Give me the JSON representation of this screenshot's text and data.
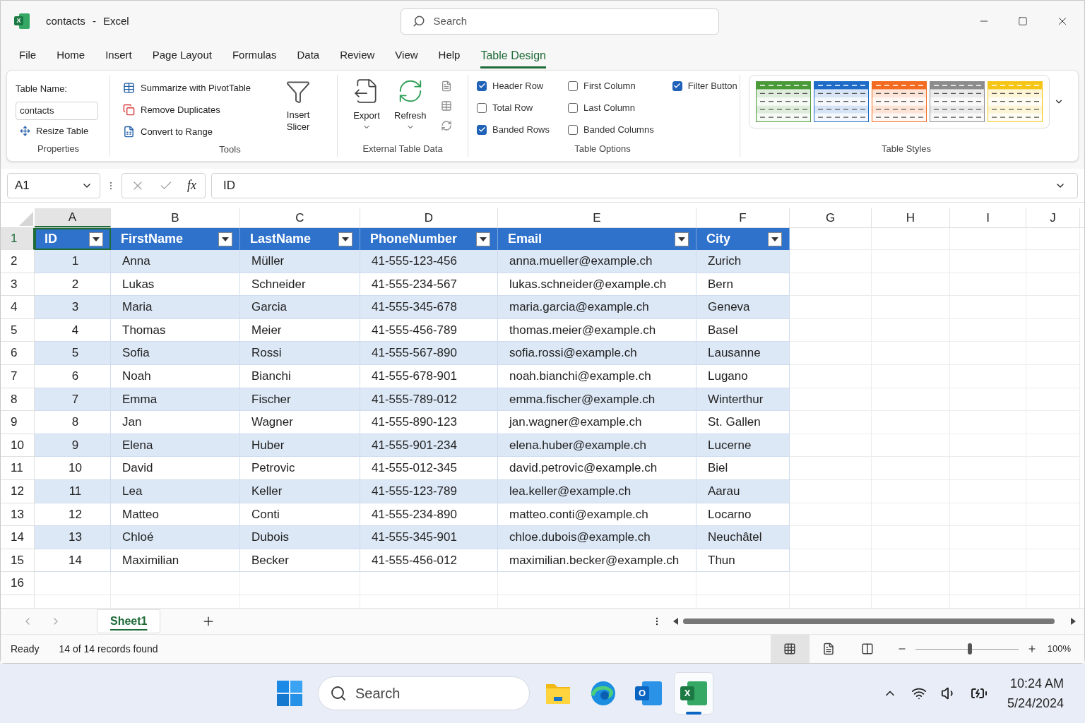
{
  "window": {
    "logo_letter": "X",
    "title": "contacts",
    "separator": "-",
    "app": "Excel",
    "search_placeholder": "Search"
  },
  "menu": [
    {
      "label": "File",
      "selected": false
    },
    {
      "label": "Home",
      "selected": false
    },
    {
      "label": "Insert",
      "selected": false
    },
    {
      "label": "Page Layout",
      "selected": false
    },
    {
      "label": "Formulas",
      "selected": false
    },
    {
      "label": "Data",
      "selected": false
    },
    {
      "label": "Review",
      "selected": false
    },
    {
      "label": "View",
      "selected": false
    },
    {
      "label": "Help",
      "selected": false
    },
    {
      "label": "Table Design",
      "selected": true
    }
  ],
  "ribbon": {
    "properties": {
      "label": "Properties",
      "table_name_label": "Table Name:",
      "table_name": "contacts",
      "resize": "Resize Table"
    },
    "tools": {
      "label": "Tools",
      "items": [
        "Summarize with PivotTable",
        "Remove Duplicates",
        "Convert to Range"
      ],
      "insert_slicer": "Insert Slicer"
    },
    "external": {
      "label": "External Table Data",
      "export": "Export",
      "refresh": "Refresh"
    },
    "table_options": {
      "label": "Table Options",
      "items": [
        {
          "label": "Header Row",
          "checked": true
        },
        {
          "label": "Total Row",
          "checked": false
        },
        {
          "label": "Banded Rows",
          "checked": true
        },
        {
          "label": "First Column",
          "checked": false
        },
        {
          "label": "Last Column",
          "checked": false
        },
        {
          "label": "Banded Columns",
          "checked": false
        },
        {
          "label": "Filter Button",
          "checked": true
        }
      ]
    },
    "table_styles": {
      "label": "Table Styles",
      "items": [
        {
          "color": "#4a9a3a"
        },
        {
          "color": "#1e6cc8"
        },
        {
          "color": "#f26b21"
        },
        {
          "color": "#8c8c8c"
        },
        {
          "color": "#f5c518"
        }
      ]
    }
  },
  "formula_bar": {
    "name_box": "A1",
    "function_label": "fx",
    "content": "ID"
  },
  "column_letters": [
    "A",
    "B",
    "C",
    "D",
    "E",
    "F",
    "G",
    "H",
    "I",
    "J"
  ],
  "table": {
    "columns": [
      "ID",
      "FirstName",
      "LastName",
      "PhoneNumber",
      "Email",
      "City"
    ],
    "rows": [
      [
        "1",
        "Anna",
        "Müller",
        "41-555-123-456",
        "anna.mueller@example.ch",
        "Zurich"
      ],
      [
        "2",
        "Lukas",
        "Schneider",
        "41-555-234-567",
        "lukas.schneider@example.ch",
        "Bern"
      ],
      [
        "3",
        "Maria",
        "Garcia",
        "41-555-345-678",
        "maria.garcia@example.ch",
        "Geneva"
      ],
      [
        "4",
        "Thomas",
        "Meier",
        "41-555-456-789",
        "thomas.meier@example.ch",
        "Basel"
      ],
      [
        "5",
        "Sofia",
        "Rossi",
        "41-555-567-890",
        "sofia.rossi@example.ch",
        "Lausanne"
      ],
      [
        "6",
        "Noah",
        "Bianchi",
        "41-555-678-901",
        "noah.bianchi@example.ch",
        "Lugano"
      ],
      [
        "7",
        "Emma",
        "Fischer",
        "41-555-789-012",
        "emma.fischer@example.ch",
        "Winterthur"
      ],
      [
        "8",
        "Jan",
        "Wagner",
        "41-555-890-123",
        "jan.wagner@example.ch",
        "St. Gallen"
      ],
      [
        "9",
        "Elena",
        "Huber",
        "41-555-901-234",
        "elena.huber@example.ch",
        "Lucerne"
      ],
      [
        "10",
        "David",
        "Petrovic",
        "41-555-012-345",
        "david.petrovic@example.ch",
        "Biel"
      ],
      [
        "11",
        "Lea",
        "Keller",
        "41-555-123-789",
        "lea.keller@example.ch",
        "Aarau"
      ],
      [
        "12",
        "Matteo",
        "Conti",
        "41-555-234-890",
        "matteo.conti@example.ch",
        "Locarno"
      ],
      [
        "13",
        "Chloé",
        "Dubois",
        "41-555-345-901",
        "chloe.dubois@example.ch",
        "Neuchâtel"
      ],
      [
        "14",
        "Maximilian",
        "Becker",
        "41-555-456-012",
        "maximilian.becker@example.ch",
        "Thun"
      ]
    ]
  },
  "row_numbers": [
    "1",
    "2",
    "3",
    "4",
    "5",
    "6",
    "7",
    "8",
    "9",
    "10",
    "11",
    "12",
    "13",
    "14",
    "15",
    "16"
  ],
  "sheets": [
    {
      "label": "Sheet1",
      "selected": true
    }
  ],
  "status": {
    "ready": "Ready",
    "records": "14 of 14 records found",
    "views": [
      {
        "kind": "normal",
        "selected": true
      },
      {
        "kind": "page_layout",
        "selected": false
      },
      {
        "kind": "page_break",
        "selected": false
      }
    ],
    "zoom": {
      "level": 0.53,
      "reading": "100%"
    }
  },
  "taskbar": {
    "search_placeholder": "Search",
    "apps": [
      {
        "kind": "explorer",
        "selected": false
      },
      {
        "kind": "edge",
        "selected": false
      },
      {
        "kind": "outlook",
        "letter": "O",
        "selected": false
      },
      {
        "kind": "excel",
        "letter": "X",
        "selected": true
      }
    ],
    "time": "10:24 AM",
    "date": "5/24/2024"
  }
}
